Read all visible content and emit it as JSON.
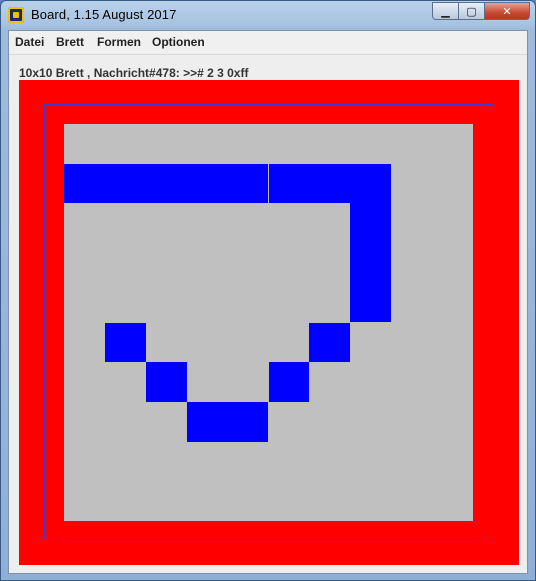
{
  "window": {
    "title": "Board, 1.15 August 2017",
    "controls": {
      "minimize": "▁",
      "maximize": "▢",
      "close": "✕"
    }
  },
  "menu": {
    "items": [
      {
        "label": "Datei"
      },
      {
        "label": "Brett"
      },
      {
        "label": "Formen"
      },
      {
        "label": "Optionen"
      }
    ]
  },
  "status_text": "10x10 Brett , Nachricht#478: >># 2 3 0xff",
  "board": {
    "rows": 10,
    "cols": 10,
    "border_color": "#ff0000",
    "background_color": "#c0c0c0",
    "on_color": "#0000ff",
    "cells": [
      [
        0,
        0,
        0,
        0,
        0,
        0,
        0,
        0,
        0,
        0
      ],
      [
        1,
        1,
        1,
        1,
        1,
        1,
        1,
        1,
        0,
        0
      ],
      [
        0,
        0,
        0,
        0,
        0,
        0,
        0,
        1,
        0,
        0
      ],
      [
        0,
        0,
        0,
        0,
        0,
        0,
        0,
        1,
        0,
        0
      ],
      [
        0,
        0,
        0,
        0,
        0,
        0,
        0,
        1,
        0,
        0
      ],
      [
        0,
        1,
        0,
        0,
        0,
        0,
        1,
        0,
        0,
        0
      ],
      [
        0,
        0,
        1,
        0,
        0,
        1,
        0,
        0,
        0,
        0
      ],
      [
        0,
        0,
        0,
        1,
        1,
        0,
        0,
        0,
        0,
        0
      ],
      [
        0,
        0,
        0,
        0,
        0,
        0,
        0,
        0,
        0,
        0
      ],
      [
        0,
        0,
        0,
        0,
        0,
        0,
        0,
        0,
        0,
        0
      ]
    ]
  }
}
